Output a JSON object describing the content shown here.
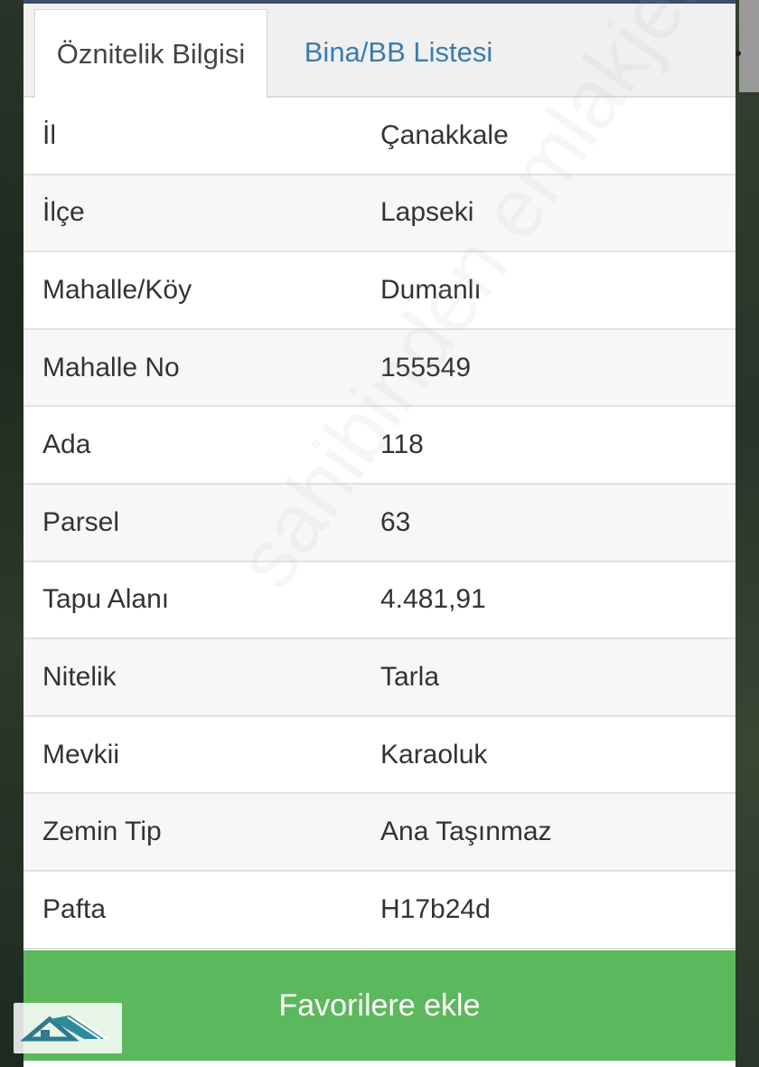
{
  "tabs": [
    {
      "label": "Öznitelik Bilgisi",
      "active": true
    },
    {
      "label": "Bina/BB Listesi",
      "active": false
    }
  ],
  "rows": [
    {
      "label": "İl",
      "value": "Çanakkale"
    },
    {
      "label": "İlçe",
      "value": "Lapseki"
    },
    {
      "label": "Mahalle/Köy",
      "value": "Dumanlı"
    },
    {
      "label": "Mahalle No",
      "value": "155549"
    },
    {
      "label": "Ada",
      "value": "118"
    },
    {
      "label": "Parsel",
      "value": "63"
    },
    {
      "label": "Tapu Alanı",
      "value": "4.481,91"
    },
    {
      "label": "Nitelik",
      "value": "Tarla"
    },
    {
      "label": "Mevkii",
      "value": "Karaoluk"
    },
    {
      "label": "Zemin Tip",
      "value": "Ana Taşınmaz"
    },
    {
      "label": "Pafta",
      "value": "H17b24d"
    }
  ],
  "favorite_button": {
    "label": "Favorilere ekle"
  },
  "watermark": {
    "text": "sahibinden emlakjet.com"
  },
  "colors": {
    "button": "#5cb85c",
    "tab_link": "#3b7bb0",
    "text": "#333333"
  },
  "icons": {
    "logo": "house-roof-logo-icon"
  }
}
